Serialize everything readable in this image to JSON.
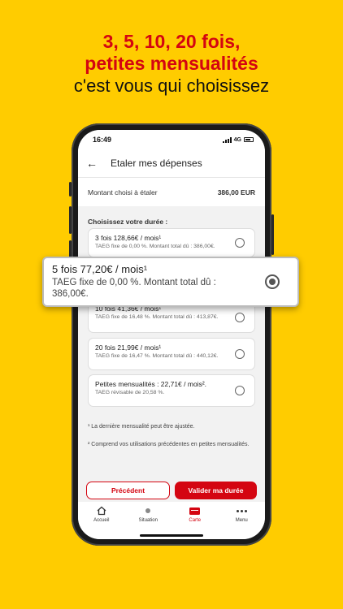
{
  "headline": {
    "line1": "3, 5, 10, 20 fois,",
    "line2": "petites mensualités",
    "line3": "c'est vous qui choisissez"
  },
  "status": {
    "time": "16:49",
    "network": "4G"
  },
  "appbar": {
    "title": "Etaler mes dépenses",
    "back_icon": "arrow-left-icon"
  },
  "amount": {
    "label": "Montant choisi à étaler",
    "value": "386,00 EUR"
  },
  "section_title": "Choisissez votre durée :",
  "options": [
    {
      "title": "3 fois 128,66€ / mois¹",
      "sub": "TAEG fixe de 0,00 %. Montant total dû : 386,00€."
    },
    {
      "title": "10 fois 41,36€ / mois¹",
      "sub": "TAEG fixe de 16,48 %. Montant total dû : 413,87€."
    },
    {
      "title": "20 fois 21,99€ / mois¹",
      "sub": "TAEG fixe de 16,47 %. Montant total dû : 440,12€."
    },
    {
      "title": "Petites mensualités : 22,71€ / mois².",
      "sub": "TAEG révisable de 20,58 %."
    }
  ],
  "selected_option": {
    "title": "5 fois 77,20€ / mois¹",
    "sub": "TAEG fixe de 0,00 %. Montant total dû : 386,00€."
  },
  "footnotes": [
    "¹ La dernière mensualité peut être ajustée.",
    "² Comprend vos utilisations précédentes en petites mensualités."
  ],
  "buttons": {
    "previous": "Précédent",
    "validate": "Valider ma durée"
  },
  "tabs": [
    {
      "label": "Accueil",
      "icon": "home-icon"
    },
    {
      "label": "Situation",
      "icon": "dot-icon"
    },
    {
      "label": "Carte",
      "icon": "card-icon"
    },
    {
      "label": "Menu",
      "icon": "more-icon"
    }
  ],
  "colors": {
    "brand_red": "#D40511",
    "brand_yellow": "#FFCC00"
  }
}
